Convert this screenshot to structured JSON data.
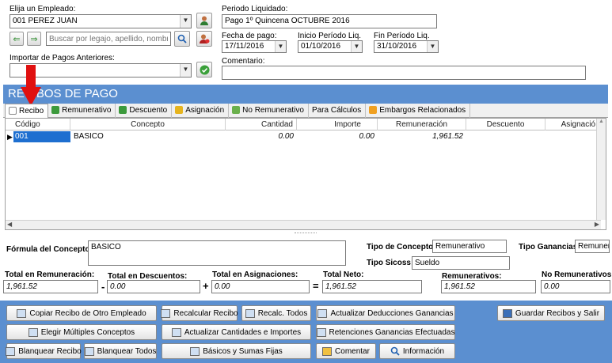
{
  "top": {
    "empleado_label": "Elija un Empleado:",
    "empleado_value": "001 PEREZ JUAN",
    "search_placeholder": "Buscar por legajo, apellido, nombre",
    "importar_label": "Importar de Pagos Anteriores:",
    "importar_value": "",
    "periodo_label": "Periodo Liquidado:",
    "periodo_value": "Pago 1º Quincena OCTUBRE 2016",
    "fecha_pago_label": "Fecha de pago:",
    "fecha_pago_value": "17/11/2016",
    "inicio_label": "Inicio Período Liq.",
    "inicio_value": "01/10/2016",
    "fin_label": "Fin Período Liq.",
    "fin_value": "31/10/2016",
    "comentario_label": "Comentario:",
    "comentario_value": ""
  },
  "panel": {
    "title": "RECIBOS DE PAGO"
  },
  "tabs": [
    {
      "label": "Recibo",
      "active": true,
      "color": "#e9eef7"
    },
    {
      "label": "Remunerativo",
      "active": false,
      "color": "#3c9a3c"
    },
    {
      "label": "Descuento",
      "active": false,
      "color": "#3c9a3c"
    },
    {
      "label": "Asignación",
      "active": false,
      "color": "#e6b41e"
    },
    {
      "label": "No Remunerativo",
      "active": false,
      "color": "#6ab04c"
    },
    {
      "label": "Para Cálculos",
      "active": false,
      "color": ""
    },
    {
      "label": "Embargos Relacionados",
      "active": false,
      "color": "#f0a020"
    }
  ],
  "grid": {
    "headers": [
      "Código",
      "Concepto",
      "Cantidad",
      "Importe",
      "Remuneración",
      "Descuento",
      "Asignació"
    ],
    "rows": [
      {
        "codigo": "001",
        "concepto": "BASICO",
        "cantidad": "0.00",
        "importe": "0.00",
        "remuneracion": "1,961.52",
        "descuento": "",
        "asignacion": ""
      }
    ]
  },
  "bottom": {
    "formula_label": "Fórmula del Concepto:",
    "formula_value": "BASICO",
    "tipo_concepto_label": "Tipo de Concepto:",
    "tipo_concepto_value": "Remunerativo",
    "tipo_ganancias_label": "Tipo Ganancias:",
    "tipo_ganancias_value": "Remuner",
    "tipo_sicoss_label": "Tipo Sicoss:",
    "tipo_sicoss_value": "Sueldo",
    "total_rem_label": "Total en Remuneración:",
    "total_rem_value": "1,961.52",
    "total_desc_label": "Total en Descuentos:",
    "total_desc_value": "0.00",
    "total_asig_label": "Total en Asignaciones:",
    "total_asig_value": "0.00",
    "total_neto_label": "Total Neto:",
    "total_neto_value": "1,961.52",
    "remunerativos_label": "Remunerativos:",
    "remunerativos_value": "1,961.52",
    "no_remunerativos_label": "No Remunerativos:",
    "no_remunerativos_value": "0.00",
    "minus": "-",
    "plus": "+",
    "equals": "="
  },
  "buttons": {
    "copiar": "Copiar Recibo de Otro Empleado",
    "recalcular": "Recalcular Recibo",
    "recalc_todos": "Recalc. Todos",
    "actualizar_deducciones": "Actualizar Deducciones Ganancias",
    "guardar": "Guardar Recibos y Salir",
    "elegir": "Elegir Múltiples Conceptos",
    "actualizar_cantidades": "Actualizar Cantidades e Importes",
    "retenciones": "Retenciones  Ganancias Efectuadas",
    "blanquear": "Blanquear Recibo",
    "blanquear_todos": "Blanquear Todos",
    "basicos": "Básicos y Sumas Fijas",
    "comentar": "Comentar",
    "informacion": "Información"
  },
  "colors": {
    "accent": "#5b8fd0",
    "selection": "#1e6fd0",
    "arrow": "#e01010"
  }
}
